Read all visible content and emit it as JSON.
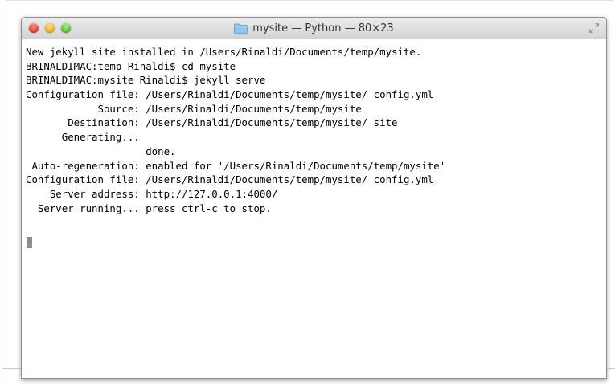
{
  "window": {
    "title": "mysite — Python — 80×23",
    "traffic_lights": {
      "close": "#e0443e",
      "minimize": "#e6b01c",
      "maximize": "#5fbf3a"
    },
    "icons": {
      "folder": "folder-icon",
      "fullscreen": "fullscreen-icon"
    }
  },
  "terminal": {
    "background": "#ffffff",
    "text_color": "#000000",
    "lines": [
      "New jekyll site installed in /Users/Rinaldi/Documents/temp/mysite.",
      "BRINALDIMAC:temp Rinaldi$ cd mysite",
      "BRINALDIMAC:mysite Rinaldi$ jekyll serve",
      "Configuration file: /Users/Rinaldi/Documents/temp/mysite/_config.yml",
      "            Source: /Users/Rinaldi/Documents/temp/mysite",
      "       Destination: /Users/Rinaldi/Documents/temp/mysite/_site",
      "      Generating...",
      "                    done.",
      " Auto-regeneration: enabled for '/Users/Rinaldi/Documents/temp/mysite'",
      "Configuration file: /Users/Rinaldi/Documents/temp/mysite/_config.yml",
      "    Server address: http://127.0.0.1:4000/",
      "  Server running... press ctrl-c to stop."
    ]
  }
}
